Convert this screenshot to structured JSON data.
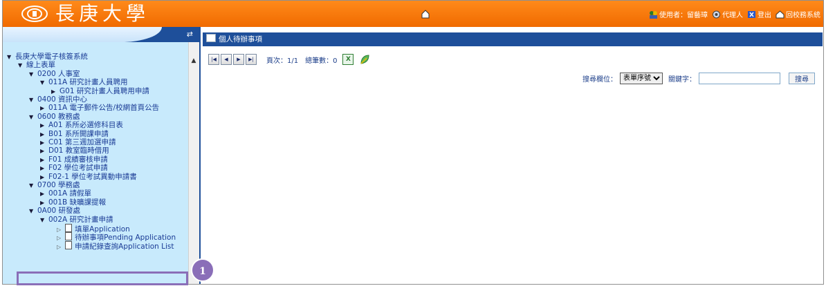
{
  "banner": {
    "logo_text": "長庚大學",
    "links": [
      {
        "label": "使用者：留藝璋",
        "icon": "users-icon"
      },
      {
        "label": "代理人",
        "icon": "agent-icon"
      },
      {
        "label": "登出",
        "icon": "logout-icon"
      },
      {
        "label": "回校務系統",
        "icon": "home-icon"
      }
    ]
  },
  "tree": {
    "swap_icon": "⇄",
    "scroll_up": "▲",
    "nodes": [
      {
        "level": 0,
        "arrow": "▼",
        "label": "長庚大學電子核簽系統"
      },
      {
        "level": 1,
        "arrow": "▼",
        "label": "線上表單"
      },
      {
        "level": 2,
        "arrow": "▼",
        "label": "0200 人事室"
      },
      {
        "level": 3,
        "arrow": "▼",
        "label": "011A 研究計畫人員聘用"
      },
      {
        "level": 4,
        "arrow": "▶",
        "label": "G01 研究計畫人員聘用申請"
      },
      {
        "level": 2,
        "arrow": "▼",
        "label": "0400 資訊中心"
      },
      {
        "level": 3,
        "arrow": "▶",
        "label": "011A 電子郵件公告/校網首頁公告"
      },
      {
        "level": 2,
        "arrow": "▼",
        "label": "0600 教務處"
      },
      {
        "level": 3,
        "arrow": "▶",
        "label": "A01 系所必選修科目表"
      },
      {
        "level": 3,
        "arrow": "▶",
        "label": "B01 系所開課申請"
      },
      {
        "level": 3,
        "arrow": "▶",
        "label": "C01 第三週加選申請"
      },
      {
        "level": 3,
        "arrow": "▶",
        "label": "D01 教室臨時借用"
      },
      {
        "level": 3,
        "arrow": "▶",
        "label": "F01 成績審核申請"
      },
      {
        "level": 3,
        "arrow": "▶",
        "label": "F02 學位考試申請"
      },
      {
        "level": 3,
        "arrow": "▶",
        "label": "F02-1 學位考試異動申請書"
      },
      {
        "level": 2,
        "arrow": "▼",
        "label": "0700 學務處"
      },
      {
        "level": 3,
        "arrow": "▶",
        "label": "001A 請假單"
      },
      {
        "level": 3,
        "arrow": "▶",
        "label": "001B 缺曠課提報"
      },
      {
        "level": 2,
        "arrow": "▼",
        "label": "0A00 研發處"
      },
      {
        "level": 3,
        "arrow": "▼",
        "label": "002A 研究計畫申請"
      },
      {
        "level": 4,
        "arrow": "▷",
        "doc": true,
        "label": "填單Application"
      },
      {
        "level": 4,
        "arrow": "▷",
        "doc": true,
        "label": "待辦事項Pending Application"
      },
      {
        "level": 4,
        "arrow": "▷",
        "doc": true,
        "label": "申請紀錄查詢Application List"
      }
    ]
  },
  "callout": {
    "number": "1"
  },
  "main": {
    "title": "個人待辦事項",
    "pager": {
      "first": "|◀",
      "prev": "◀",
      "next": "▶",
      "last": "▶|",
      "page_label": "頁次：1/1",
      "count_label": "總筆數：0",
      "export_icon": "excel-icon"
    },
    "search": {
      "field_label": "搜尋欄位：",
      "field_selected": "表單序號",
      "keyword_label": "關鍵字：",
      "keyword_value": "",
      "button": "搜尋"
    }
  }
}
